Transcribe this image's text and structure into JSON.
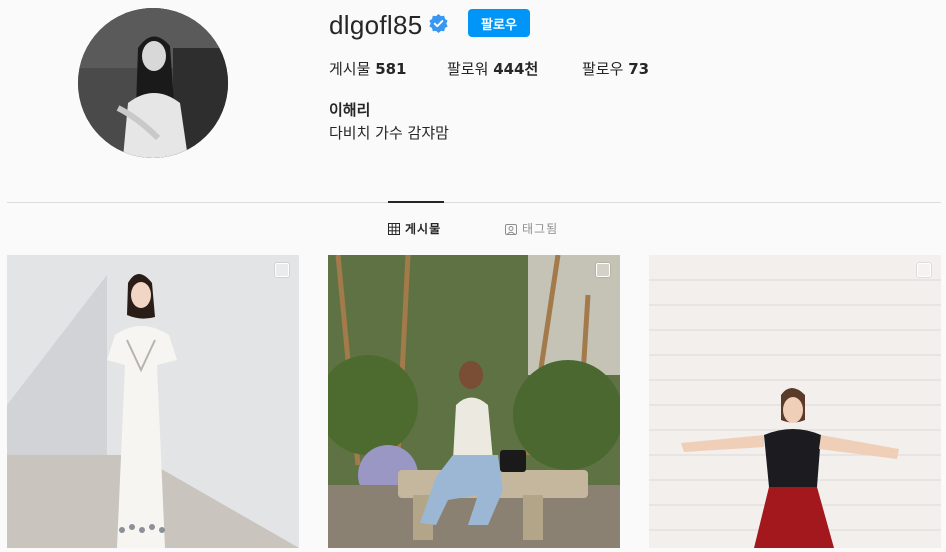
{
  "profile": {
    "username": "dlgofl85",
    "verified": true,
    "follow_label": "팔로우",
    "full_name": "이해리",
    "bio": "다비치 가수 감쟈맘",
    "avatar_icon": "profile-photo"
  },
  "stats": {
    "posts_label": "게시물",
    "posts_value": "581",
    "followers_label": "팔로워",
    "followers_value": "444천",
    "following_label": "팔로우",
    "following_value": "73"
  },
  "tabs": [
    {
      "label": "게시물",
      "icon": "grid-icon",
      "active": true
    },
    {
      "label": "태그됨",
      "icon": "tag-icon",
      "active": false
    }
  ],
  "posts": [
    {
      "icon": "multi-photo-icon"
    },
    {
      "icon": "multi-photo-icon"
    },
    {
      "icon": "multi-photo-icon"
    }
  ],
  "colors": {
    "accent": "#0095f6",
    "verified": "#3897f0",
    "text": "#262626",
    "muted": "#8e8e8e",
    "divider": "#dbdbdb"
  }
}
